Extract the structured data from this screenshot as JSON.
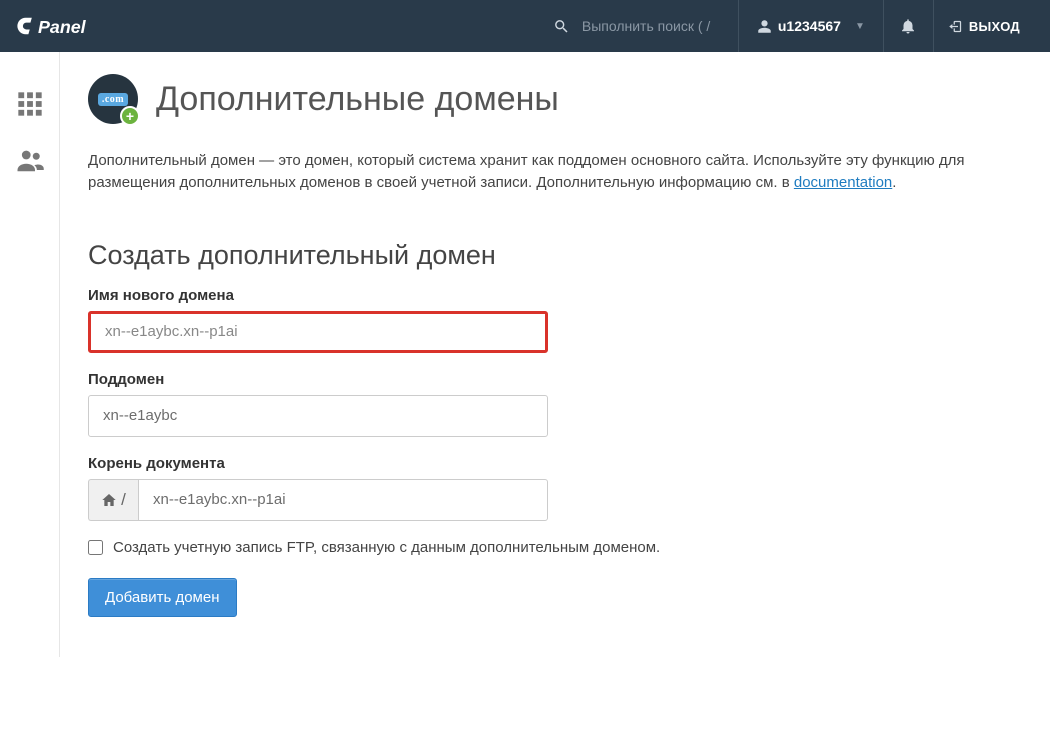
{
  "header": {
    "search_placeholder": "Выполнить поиск ( /",
    "username": "u1234567",
    "logout_label": "ВЫХОД"
  },
  "page": {
    "title": "Дополнительные домены",
    "intro_prefix": "Дополнительный домен — это домен, который система хранит как поддомен основного сайта. Используйте эту функцию для размещения дополнительных доменов в своей учетной записи. Дополнительную информацию см. в ",
    "intro_link": "documentation",
    "intro_suffix": "."
  },
  "form": {
    "section_title": "Создать дополнительный домен",
    "domain_label": "Имя нового домена",
    "domain_value": "xn--e1aybc.xn--p1ai",
    "subdomain_label": "Поддомен",
    "subdomain_value": "xn--e1aybc",
    "docroot_label": "Корень документа",
    "docroot_prefix": "🏠 /",
    "docroot_value": "xn--e1aybc.xn--p1ai",
    "ftp_checkbox_label": "Создать учетную запись FTP, связанную с данным дополнительным доменом.",
    "submit_label": "Добавить домен"
  },
  "page_icon": {
    "badge_text": ".com"
  }
}
